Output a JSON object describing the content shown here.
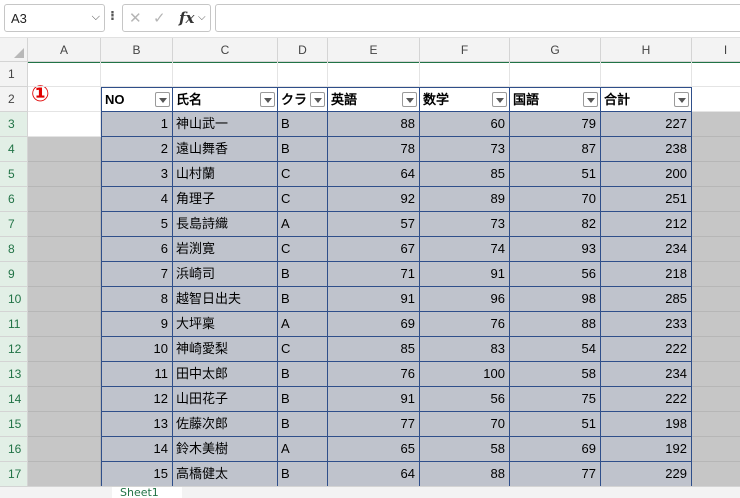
{
  "formula_bar": {
    "name_box": "A3",
    "formula": ""
  },
  "columns": [
    "A",
    "B",
    "C",
    "D",
    "E",
    "F",
    "G",
    "H",
    "I"
  ],
  "table_headers": [
    "NO",
    "氏名",
    "クラ",
    "英語",
    "数学",
    "国語",
    "合計"
  ],
  "annotation_marker": "①",
  "rows": [
    {
      "row": "3",
      "no": "1",
      "name": "神山武一",
      "cls": "B",
      "eng": "88",
      "math": "60",
      "jpn": "79",
      "total": "227"
    },
    {
      "row": "4",
      "no": "2",
      "name": "遠山舞香",
      "cls": "B",
      "eng": "78",
      "math": "73",
      "jpn": "87",
      "total": "238"
    },
    {
      "row": "5",
      "no": "3",
      "name": "山村蘭",
      "cls": "C",
      "eng": "64",
      "math": "85",
      "jpn": "51",
      "total": "200"
    },
    {
      "row": "6",
      "no": "4",
      "name": "角理子",
      "cls": "C",
      "eng": "92",
      "math": "89",
      "jpn": "70",
      "total": "251"
    },
    {
      "row": "7",
      "no": "5",
      "name": "長島詩織",
      "cls": "A",
      "eng": "57",
      "math": "73",
      "jpn": "82",
      "total": "212"
    },
    {
      "row": "8",
      "no": "6",
      "name": "岩渕寛",
      "cls": "C",
      "eng": "67",
      "math": "74",
      "jpn": "93",
      "total": "234"
    },
    {
      "row": "9",
      "no": "7",
      "name": "浜崎司",
      "cls": "B",
      "eng": "71",
      "math": "91",
      "jpn": "56",
      "total": "218"
    },
    {
      "row": "10",
      "no": "8",
      "name": "越智日出夫",
      "cls": "B",
      "eng": "91",
      "math": "96",
      "jpn": "98",
      "total": "285"
    },
    {
      "row": "11",
      "no": "9",
      "name": "大坪稟",
      "cls": "A",
      "eng": "69",
      "math": "76",
      "jpn": "88",
      "total": "233"
    },
    {
      "row": "12",
      "no": "10",
      "name": "神崎愛梨",
      "cls": "C",
      "eng": "85",
      "math": "83",
      "jpn": "54",
      "total": "222"
    },
    {
      "row": "13",
      "no": "11",
      "name": "田中太郎",
      "cls": "B",
      "eng": "76",
      "math": "100",
      "jpn": "58",
      "total": "234"
    },
    {
      "row": "14",
      "no": "12",
      "name": "山田花子",
      "cls": "B",
      "eng": "91",
      "math": "56",
      "jpn": "75",
      "total": "222"
    },
    {
      "row": "15",
      "no": "13",
      "name": "佐藤次郎",
      "cls": "B",
      "eng": "77",
      "math": "70",
      "jpn": "51",
      "total": "198"
    },
    {
      "row": "16",
      "no": "14",
      "name": "鈴木美樹",
      "cls": "A",
      "eng": "65",
      "math": "58",
      "jpn": "69",
      "total": "192"
    },
    {
      "row": "17",
      "no": "15",
      "name": "高橋健太",
      "cls": "B",
      "eng": "64",
      "math": "88",
      "jpn": "77",
      "total": "229"
    }
  ],
  "sheet_tab": "Sheet1",
  "colors": {
    "accent": "#217346",
    "selection": "#c6c6c6",
    "table_border": "#2f4f8a",
    "marker": "#e00000"
  }
}
